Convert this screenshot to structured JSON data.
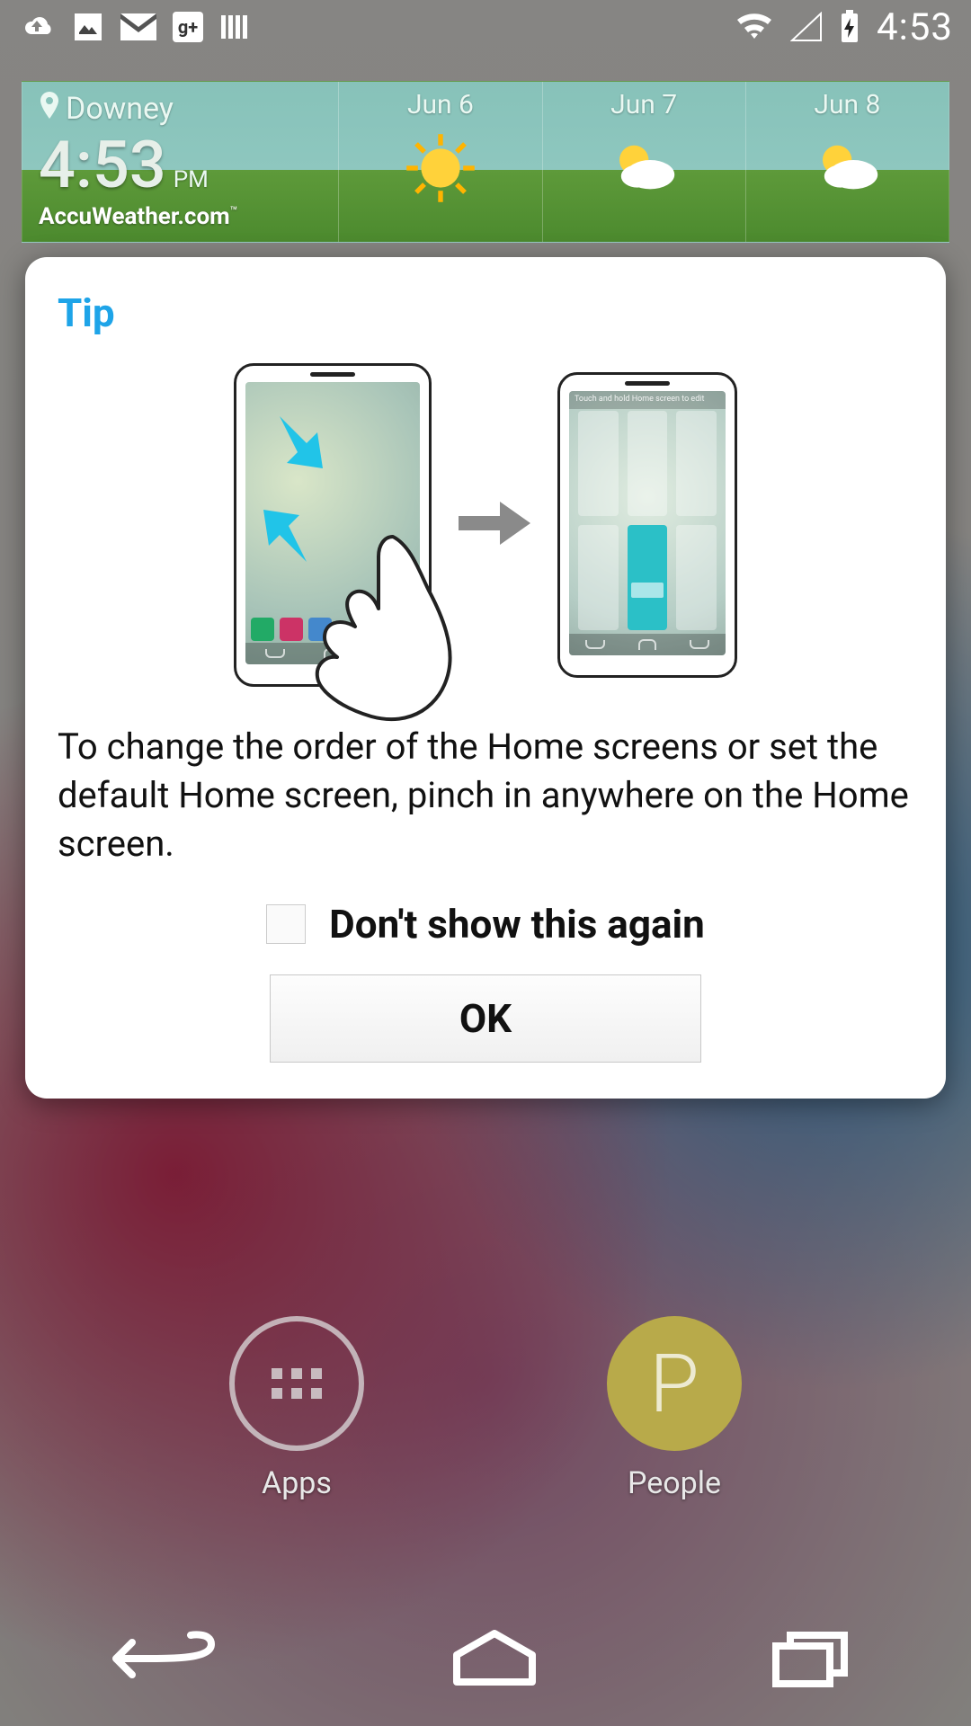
{
  "status": {
    "clock": "4:53"
  },
  "weather": {
    "location": "Downey",
    "time": "4:53",
    "ampm": "PM",
    "brand": "AccuWeather.com",
    "forecast": [
      {
        "date": "Jun 6"
      },
      {
        "date": "Jun 7"
      },
      {
        "date": "Jun 8"
      }
    ]
  },
  "home": {
    "apps_label": "Apps",
    "people_label": "People",
    "people_initial": "P"
  },
  "dialog": {
    "title": "Tip",
    "body": "To change the order of the Home screens or set the default Home screen, pinch in anywhere on the Home screen.",
    "dont_show_label": "Don't show this again",
    "ok_label": "OK",
    "overview_hint": "Touch and hold Home screen to edit"
  }
}
